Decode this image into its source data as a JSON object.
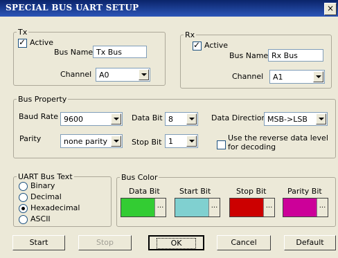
{
  "window": {
    "title": "SPECIAL BUS UART SETUP",
    "close_glyph": "×"
  },
  "tx": {
    "legend": "Tx",
    "active_label": "Active",
    "active_checked": true,
    "bus_name_label": "Bus Name",
    "bus_name_value": "Tx Bus",
    "channel_label": "Channel",
    "channel_value": "A0"
  },
  "rx": {
    "legend": "Rx",
    "active_label": "Active",
    "active_checked": true,
    "bus_name_label": "Bus Name",
    "bus_name_value": "Rx Bus",
    "channel_label": "Channel",
    "channel_value": "A1"
  },
  "bus_property": {
    "legend": "Bus Property",
    "baud_rate_label": "Baud Rate",
    "baud_rate_value": "9600",
    "data_bit_label": "Data Bit",
    "data_bit_value": "8",
    "data_direction_label": "Data Direction",
    "data_direction_value": "MSB->LSB",
    "parity_label": "Parity",
    "parity_value": "none parity",
    "stop_bit_label": "Stop Bit",
    "stop_bit_value": "1",
    "reverse_label_line1": "Use the reverse data level",
    "reverse_label_line2": "for decoding",
    "reverse_checked": false
  },
  "uart_bus_text": {
    "legend": "UART Bus Text",
    "options": [
      "Binary",
      "Decimal",
      "Hexadecimal",
      "ASCII"
    ],
    "selected": "Hexadecimal"
  },
  "bus_color": {
    "legend": "Bus Color",
    "items": [
      {
        "label": "Data Bit",
        "color": "#33cc33"
      },
      {
        "label": "Start Bit",
        "color": "#80d0d0"
      },
      {
        "label": "Stop Bit",
        "color": "#cc0000"
      },
      {
        "label": "Parity Bit",
        "color": "#cc0099"
      }
    ],
    "dots": "..."
  },
  "buttons": {
    "start": "Start",
    "stop": "Stop",
    "ok": "OK",
    "cancel": "Cancel",
    "default": "Default"
  }
}
